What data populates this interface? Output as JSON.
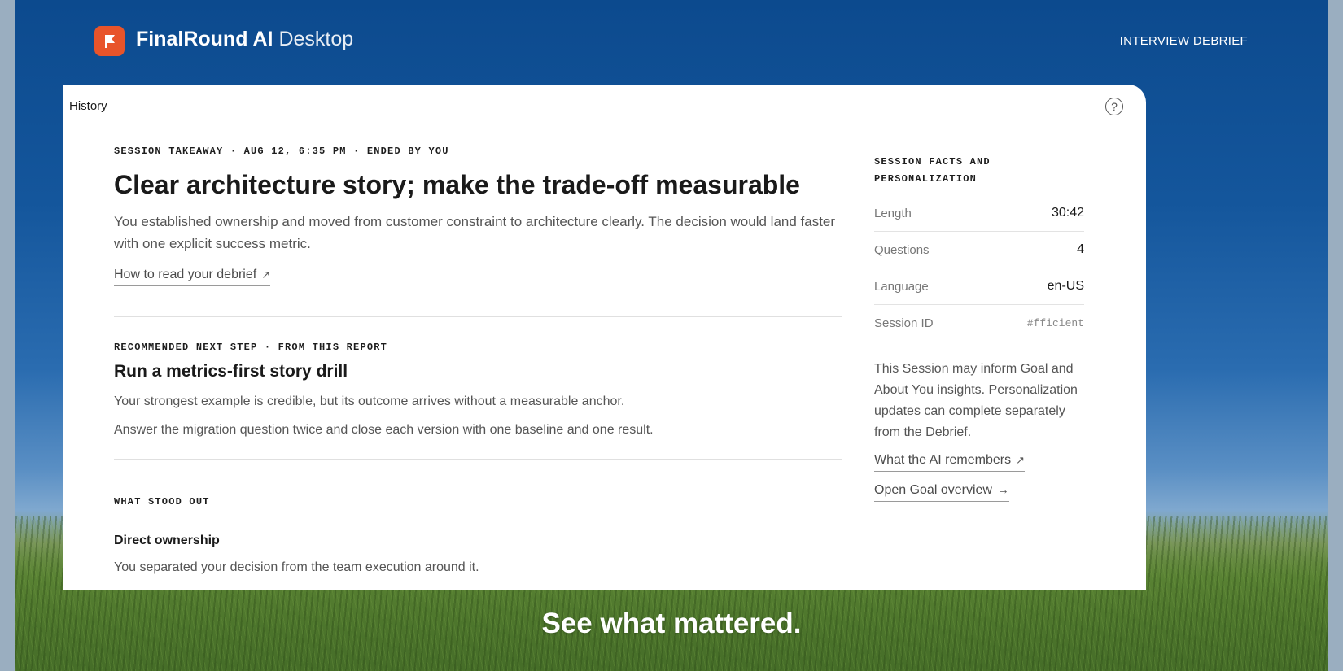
{
  "app": {
    "brand_bold": "FinalRound AI",
    "brand_light": "Desktop",
    "nav_label": "INTERVIEW DEBRIEF",
    "logo_color": "#e8542a"
  },
  "window": {
    "title": "History",
    "help_icon_glyph": "?"
  },
  "takeaway": {
    "meta": "SESSION TAKEAWAY · AUG 12, 6:35 PM · ENDED BY YOU",
    "headline": "Clear architecture story; make the trade-off measurable",
    "summary": "You established ownership and moved from customer constraint to architecture clearly. The decision would land faster with one explicit success metric.",
    "read_link": "How to read your debrief",
    "arrow": "↗"
  },
  "next_step": {
    "meta": "RECOMMENDED NEXT STEP · FROM THIS REPORT",
    "title": "Run a metrics-first story drill",
    "line1": "Your strongest example is credible, but its outcome arrives without a measurable anchor.",
    "line2": "Answer the migration question twice and close each version with one baseline and one result."
  },
  "stood_out": {
    "meta": "WHAT STOOD OUT",
    "title": "Direct ownership",
    "text": "You separated your decision from the team execution around it."
  },
  "facts": {
    "heading": "SESSION FACTS AND PERSONALIZATION",
    "length_label": "Length",
    "length_value": "30:42",
    "questions_label": "Questions",
    "questions_value": "4",
    "language_label": "Language",
    "language_value": "en-US",
    "session_label": "Session ID",
    "session_value": "#fficient",
    "note": "This Session may inform Goal and About You insights. Personalization updates can complete separately from the Debrief.",
    "remembers_link": "What the AI remembers",
    "remembers_arrow": "↗",
    "goal_link": "Open Goal overview",
    "goal_arrow": "→"
  },
  "caption": "See what mattered."
}
